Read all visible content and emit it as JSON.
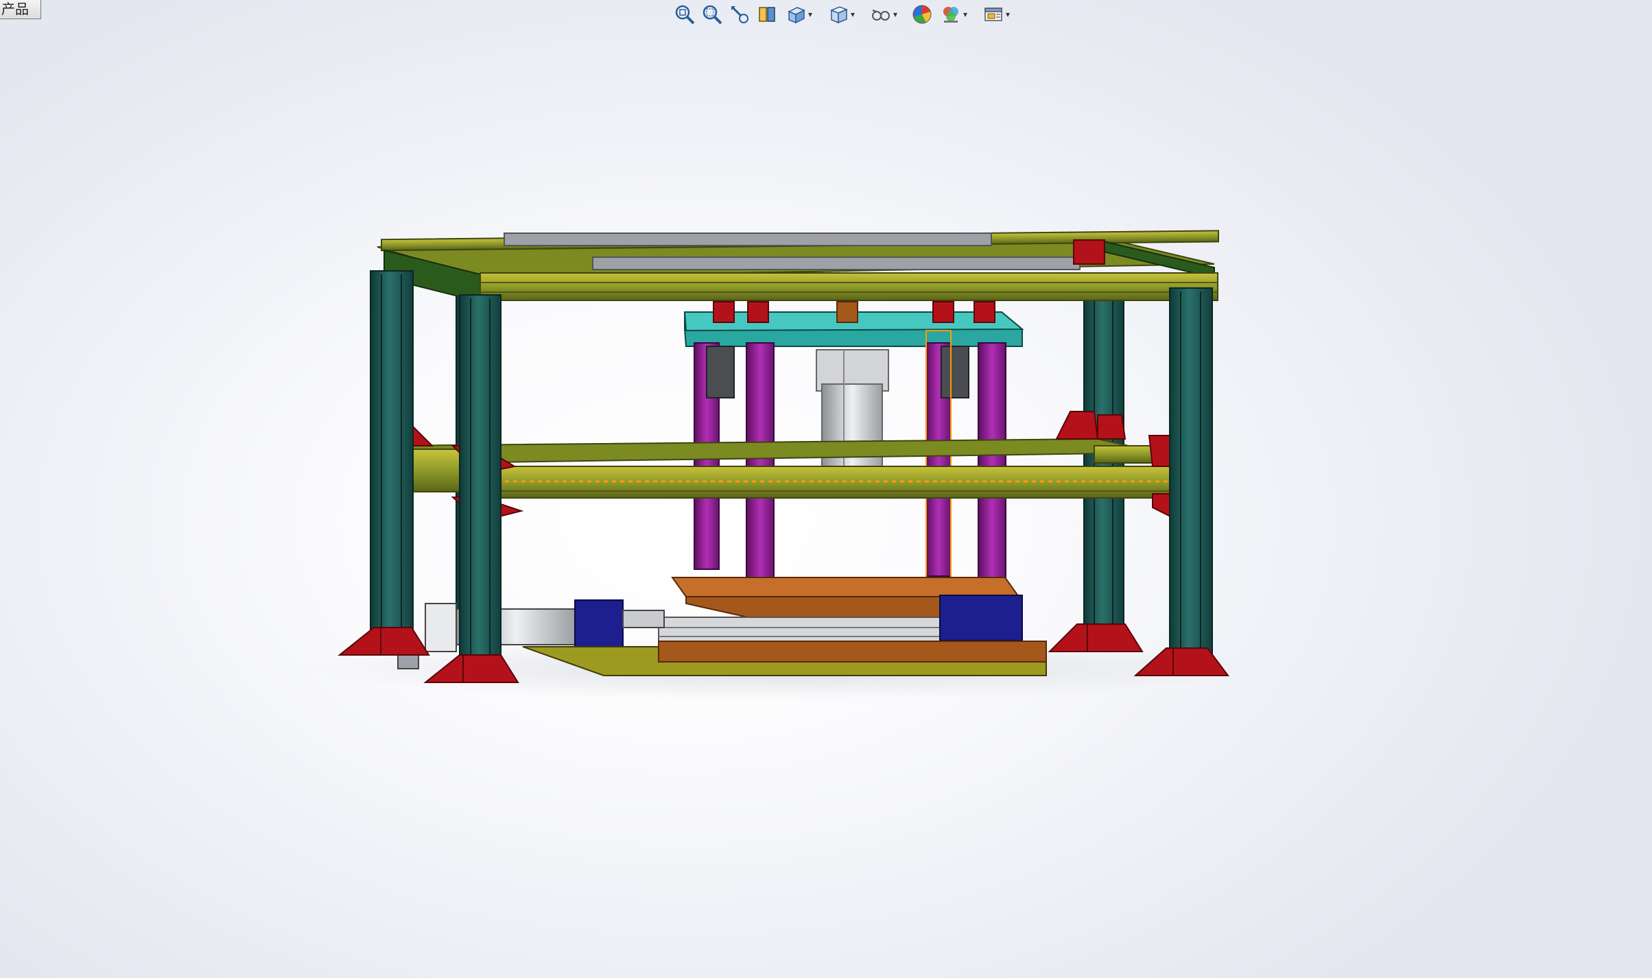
{
  "document_tab": {
    "label": "产品"
  },
  "heads_up_toolbar": {
    "buttons": [
      {
        "icon": "zoom-to-fit-icon",
        "has_dropdown": false
      },
      {
        "icon": "zoom-to-area-icon",
        "has_dropdown": false
      },
      {
        "icon": "previous-view-icon",
        "has_dropdown": false
      },
      {
        "icon": "section-view-icon",
        "has_dropdown": false
      },
      {
        "icon": "view-orientation-icon",
        "has_dropdown": true
      },
      {
        "icon": "display-style-icon",
        "has_dropdown": true
      },
      {
        "icon": "hide-show-items-icon",
        "has_dropdown": true
      },
      {
        "icon": "edit-appearance-icon",
        "has_dropdown": false
      },
      {
        "icon": "apply-scene-icon",
        "has_dropdown": true
      },
      {
        "icon": "view-settings-icon",
        "has_dropdown": true
      }
    ],
    "caret_glyph": "▾"
  },
  "model": {
    "name": "",
    "colors": {
      "frame_column": "#1f5a56",
      "frame_beam": "#8f9a2a",
      "beam_highlight": "#c9c23a",
      "corner_bracket": "#b3121a",
      "top_plate": "#2aa7a0",
      "guide_post": "#8e1b91",
      "cylinder": "#c8cacd",
      "lower_plate": "#a5581c",
      "base_plate": "#9c9a20",
      "slide_block": "#1d1f8e",
      "selection_outline": "#ff9a00"
    }
  }
}
